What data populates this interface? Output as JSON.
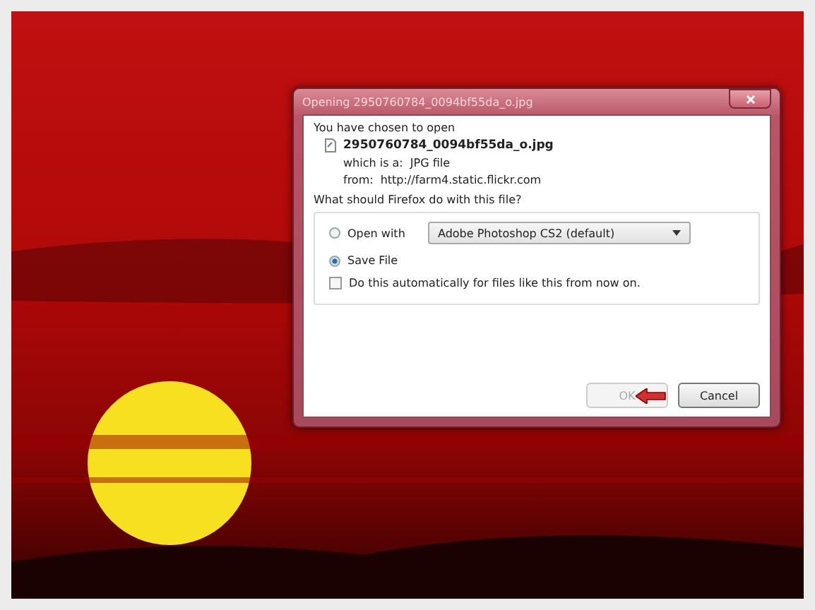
{
  "dialog": {
    "title": "Opening 2950760784_0094bf55da_o.jpg",
    "intro": "You have chosen to open",
    "file": {
      "name": "2950760784_0094bf55da_o.jpg",
      "type_label": "which is a:",
      "type": "JPG file",
      "from_label": "from:",
      "from": "http://farm4.static.flickr.com"
    },
    "question": "What should Firefox do with this file?",
    "options": [
      {
        "kind": "radio-select",
        "label": "Open with",
        "selected": false,
        "value": "Adobe Photoshop CS2 (default)"
      },
      {
        "kind": "radio",
        "label": "Save File",
        "selected": true
      }
    ],
    "auto": {
      "label": "Do this automatically for files like this from now on.",
      "checked": false
    },
    "buttons": [
      {
        "label": "OK",
        "disabled": true
      },
      {
        "label": "Cancel",
        "disabled": false
      }
    ]
  }
}
